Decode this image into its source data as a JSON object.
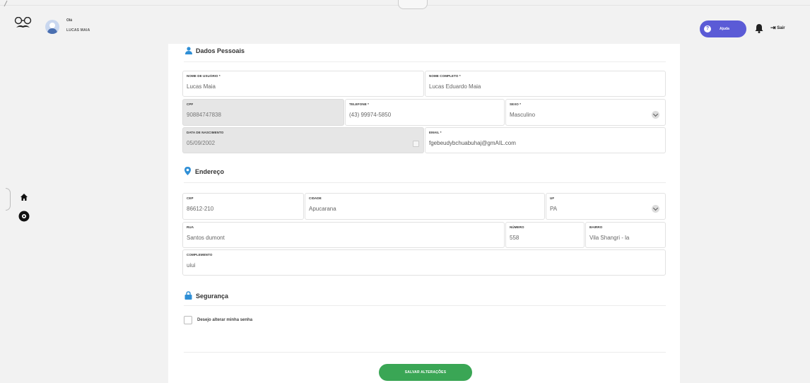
{
  "header": {
    "greeting": "Olá",
    "username": "LUCAS MAIA",
    "help_label": "Ajuda",
    "exit_label": "Sair",
    "help_color": "#5b5bd6"
  },
  "sidebar": {
    "icons": [
      "home-icon",
      "gear-icon"
    ]
  },
  "sections": {
    "personal": {
      "title": "Dados Pessoais",
      "icon": "user-icon"
    },
    "address": {
      "title": "Endereço",
      "icon": "location-pin-icon"
    },
    "security": {
      "title": "Segurança",
      "icon": "lock-icon"
    }
  },
  "fields": {
    "username": {
      "label": "NOME DE USUÁRIO *",
      "value": "Lucas Maia"
    },
    "fullname": {
      "label": "NOME COMPLETO *",
      "value": "Lucas Eduardo Maia"
    },
    "cpf": {
      "label": "CPF",
      "value": "90884747838"
    },
    "phone": {
      "label": "TELEFONE *",
      "value": "(43) 99974-5850"
    },
    "sex": {
      "label": "SEXO *",
      "value": "Masculino"
    },
    "birthdate": {
      "label": "DATA DE NASCIMENTO",
      "value": "05/09/2002"
    },
    "email": {
      "label": "EMAIL *",
      "value": "fgebeudybchuabuhaj@gmAIL.com"
    },
    "cep": {
      "label": "CEP",
      "value": "86612-210"
    },
    "city": {
      "label": "CIDADE",
      "value": "Apucarana"
    },
    "state": {
      "label": "UF",
      "value": "PA"
    },
    "street": {
      "label": "RUA",
      "value": "Santos dumont"
    },
    "number": {
      "label": "NÚMERO",
      "value": "558"
    },
    "district": {
      "label": "BAIRRO",
      "value": "Vila Shangri - la"
    },
    "complement": {
      "label": "COMPLEMENTO",
      "value": "uiui"
    }
  },
  "password_change": {
    "label": "Desejo alterar minha senha",
    "checked": false
  },
  "save_button": {
    "label": "SALVAR ALTERAÇÕES",
    "color": "#3aa655"
  }
}
